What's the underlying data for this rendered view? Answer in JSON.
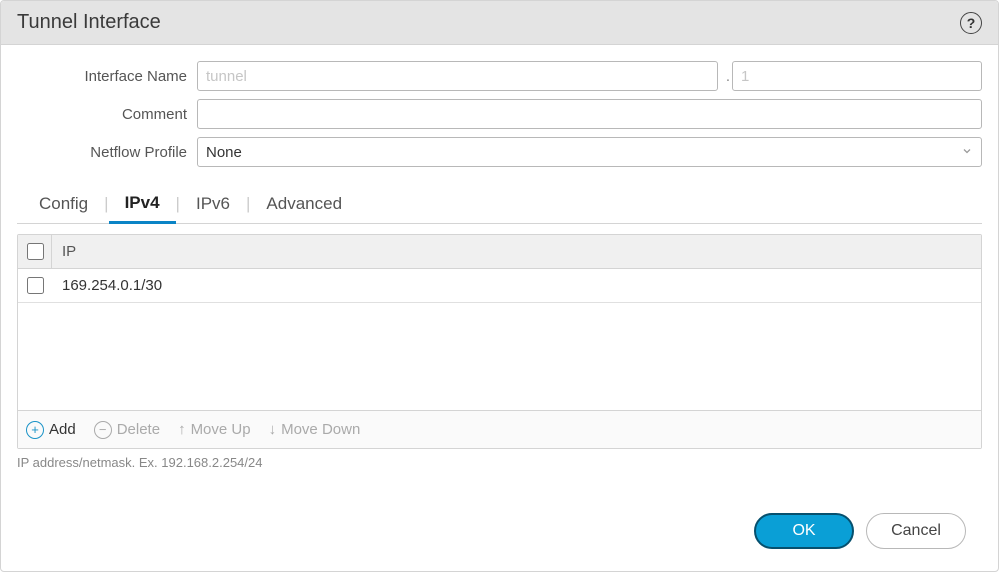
{
  "header": {
    "title": "Tunnel Interface"
  },
  "form": {
    "interface_name_label": "Interface Name",
    "interface_name_placeholder": "tunnel",
    "interface_name_value": "",
    "interface_num_placeholder": "1",
    "interface_num_value": "",
    "comment_label": "Comment",
    "comment_value": "",
    "netflow_label": "Netflow Profile",
    "netflow_value": "None"
  },
  "tabs": [
    "Config",
    "IPv4",
    "IPv6",
    "Advanced"
  ],
  "active_tab_index": 1,
  "table": {
    "header": "IP",
    "rows": [
      {
        "ip": "169.254.0.1/30"
      }
    ]
  },
  "toolbar": {
    "add": "Add",
    "delete": "Delete",
    "move_up": "Move Up",
    "move_down": "Move Down"
  },
  "hint": "IP address/netmask. Ex. 192.168.2.254/24",
  "footer": {
    "ok": "OK",
    "cancel": "Cancel"
  }
}
